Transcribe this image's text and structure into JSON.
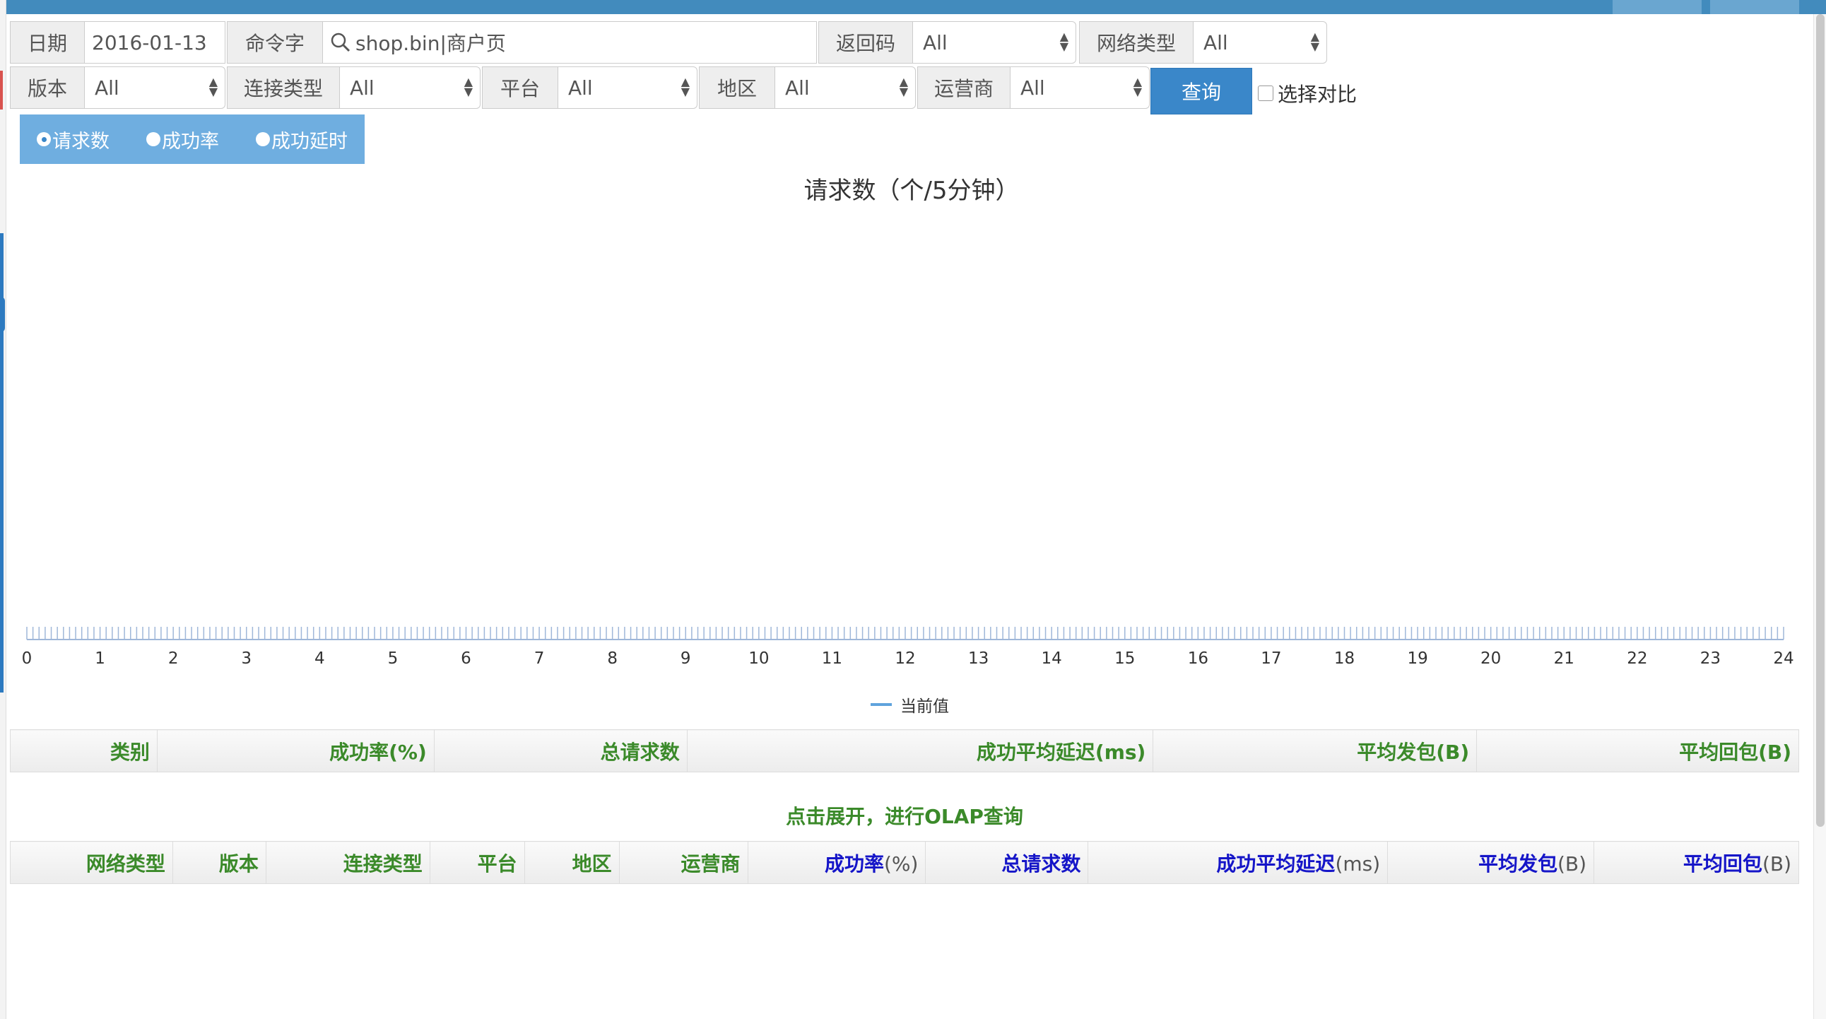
{
  "filters": {
    "date_label": "日期",
    "date_value": "2016-01-13",
    "command_label": "命令字",
    "command_value": "shop.bin|商户页",
    "return_code_label": "返回码",
    "return_code_value": "All",
    "network_type_label": "网络类型",
    "network_type_value": "All",
    "version_label": "版本",
    "version_value": "All",
    "connection_type_label": "连接类型",
    "connection_type_value": "All",
    "platform_label": "平台",
    "platform_value": "All",
    "region_label": "地区",
    "region_value": "All",
    "operator_label": "运营商",
    "operator_value": "All",
    "query_button": "查询",
    "compare_label": "选择对比"
  },
  "metric_tabs": [
    {
      "label": "请求数",
      "selected": true
    },
    {
      "label": "成功率",
      "selected": false
    },
    {
      "label": "成功延时",
      "selected": false
    }
  ],
  "chart_data": {
    "type": "line",
    "title": "请求数（个/5分钟）",
    "x_ticks": [
      "0",
      "1",
      "2",
      "3",
      "4",
      "5",
      "6",
      "7",
      "8",
      "9",
      "10",
      "11",
      "12",
      "13",
      "14",
      "15",
      "16",
      "17",
      "18",
      "19",
      "20",
      "21",
      "22",
      "23",
      "24"
    ],
    "xlim": [
      0,
      24
    ],
    "series": [
      {
        "name": "当前值",
        "color": "#5fa3dd",
        "values": []
      }
    ],
    "legend_position": "bottom-center",
    "grid": false
  },
  "summary_table": {
    "headers": [
      "类别",
      "成功率(%)",
      "总请求数",
      "成功平均延迟(ms)",
      "平均发包(B)",
      "平均回包(B)"
    ]
  },
  "olap_hint": "点击展开，进行OLAP查询",
  "olap_table": {
    "headers": [
      {
        "label": "网络类型"
      },
      {
        "label": "版本"
      },
      {
        "label": "连接类型"
      },
      {
        "label": "平台"
      },
      {
        "label": "地区"
      },
      {
        "label": "运营商"
      },
      {
        "label": "成功率",
        "unit": "(%)"
      },
      {
        "label": "总请求数"
      },
      {
        "label": "成功平均延迟",
        "unit": "(ms)"
      },
      {
        "label": "平均发包",
        "unit": "(B)"
      },
      {
        "label": "平均回包",
        "unit": "(B)"
      }
    ]
  }
}
